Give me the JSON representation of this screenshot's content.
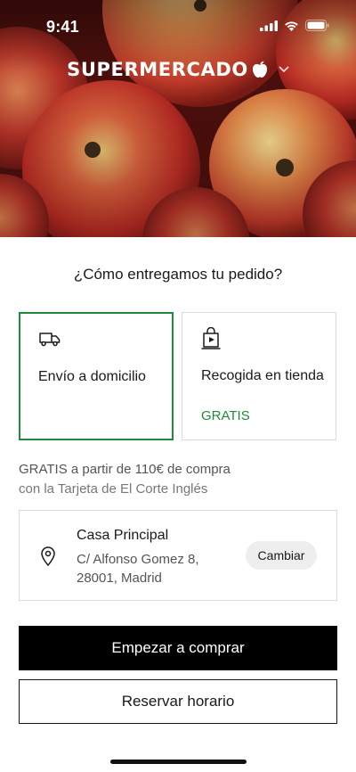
{
  "status_bar": {
    "time": "9:41"
  },
  "header": {
    "brand": "SUPERMERCADO"
  },
  "delivery": {
    "question": "¿Cómo entregamos tu pedido?",
    "options": [
      {
        "label": "Envío a domicilio",
        "selected": true,
        "icon": "truck-icon"
      },
      {
        "label": "Recogida en tienda",
        "badge": "GRATIS",
        "selected": false,
        "icon": "store-bag-icon"
      }
    ]
  },
  "promo": {
    "line1": "GRATIS a partir de 110€ de compra",
    "line2": "con la Tarjeta de El Corte Inglés"
  },
  "address": {
    "name": "Casa Principal",
    "line1": "C/ Alfonso Gomez 8,",
    "line2": "28001, Madrid",
    "change_label": "Cambiar"
  },
  "actions": {
    "primary": "Empezar a comprar",
    "secondary": "Reservar horario"
  },
  "colors": {
    "accent_green": "#1f8a3b",
    "primary_button": "#000000"
  }
}
